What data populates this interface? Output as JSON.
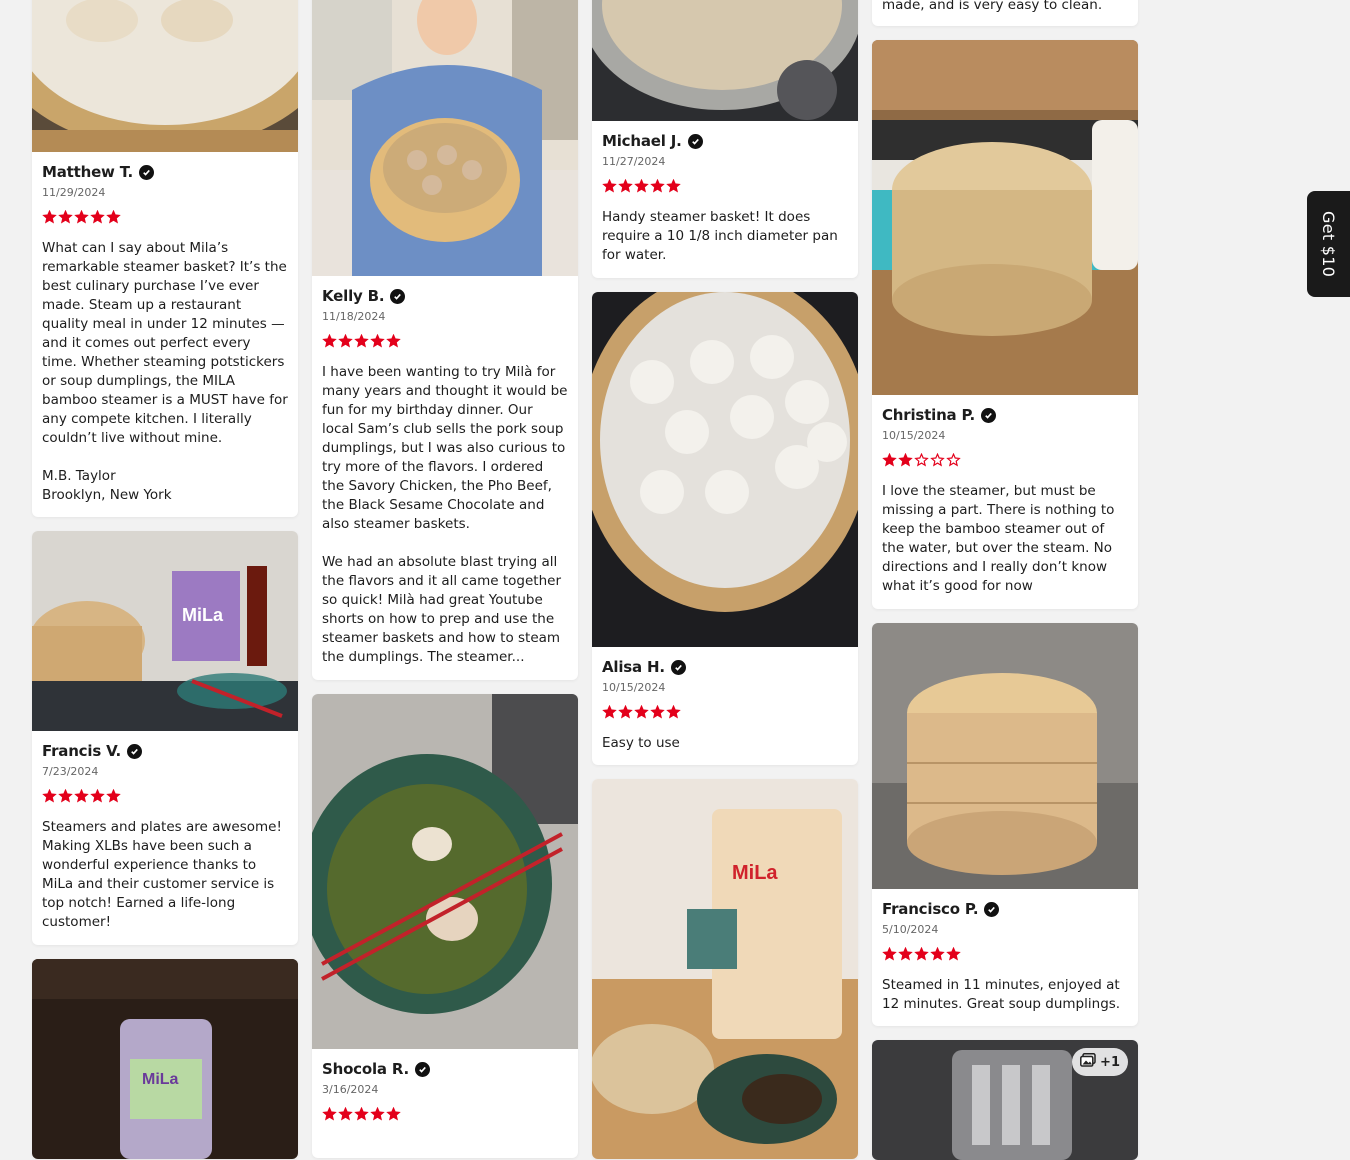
{
  "colors": {
    "star": "#e3001b",
    "star_empty": "#e3001b",
    "page_bg": "#f2f2f2"
  },
  "get_ten": {
    "label": "Get $10"
  },
  "reviews": [
    {
      "name": "Matthew T.",
      "date": "11/29/2024",
      "rating": 5,
      "text": "What can I say about Mila’s remarkable steamer basket? It’s the best culinary purchase I’ve ever made. Steam up a restaurant quality meal in under 12 minutes — and it comes out perfect every time. Whether steaming potstickers or soup dumplings, the MILA bamboo steamer is a MUST have for any compete kitchen. I literally couldn’t live without mine.\n\nM.B. Taylor\nBrooklyn, New York"
    },
    {
      "name": "Francis V.",
      "date": "7/23/2024",
      "rating": 5,
      "text": "Steamers and plates are awesome! Making XLBs have been such a wonderful experience thanks to MiLa and their customer service is top notch!  Earned a life-long customer!"
    },
    {
      "name": "Kelly B.",
      "date": "11/18/2024",
      "rating": 5,
      "text": "I have been wanting to try Milà for many years and thought it would be fun for my birthday dinner. Our local Sam’s club sells the pork soup dumplings, but I was also curious to try more of the flavors. I ordered the Savory Chicken, the Pho Beef, the Black Sesame Chocolate and also steamer baskets.\n\nWe had an absolute blast trying all the flavors and it all came together so quick! Milà had great Youtube shorts on how to prep and use the steamer baskets and how to steam the dumplings. The steamer..."
    },
    {
      "name": "Shocola R.",
      "date": "3/16/2024",
      "rating": 5,
      "text": ""
    },
    {
      "name": "Michael J.",
      "date": "11/27/2024",
      "rating": 5,
      "text": "Handy steamer basket! It does require a 10 1/8 inch diameter pan for water."
    },
    {
      "name": "Alisa H.",
      "date": "10/15/2024",
      "rating": 5,
      "text": "Easy to use"
    },
    {
      "name": "Christina P.",
      "date": "10/15/2024",
      "rating": 2,
      "text": "I love the steamer, but must be missing a part. There is nothing to keep the bamboo steamer out of the water, but over the steam. No directions and I really don’t know what it’s good for now"
    },
    {
      "name": "Francisco P.",
      "date": "5/10/2024",
      "rating": 5,
      "text": "Steamed in 11 minutes, enjoyed at 12 minutes. Great soup dumplings."
    }
  ],
  "top_snippet": {
    "text": "made, and is very easy to clean."
  },
  "photo_badge": {
    "count": "+1",
    "icon": "photos-icon"
  },
  "photo_labels": {
    "mila_brand": "MiLa"
  }
}
